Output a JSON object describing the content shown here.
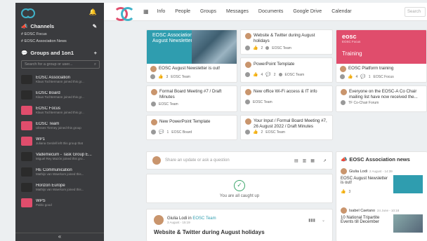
{
  "sidebar": {
    "channels_label": "Channels",
    "channels": [
      "# EOSC Focus",
      "# EOSC Association News"
    ],
    "groups_label": "Groups and 1on1",
    "search_placeholder": "Search for a group or user...",
    "groups": [
      {
        "name": "EOSC Association",
        "sub": "Klaus Tochtermann joined this gr...",
        "color": "#2b2b2b"
      },
      {
        "name": "EOSC Board",
        "sub": "Klaus Tochtermann joined this gr...",
        "color": "#2b2b2b"
      },
      {
        "name": "EOSC Focus",
        "sub": "Klaus Tochtermann joined this gr...",
        "color": "#e04d6c"
      },
      {
        "name": "EOSC Team",
        "sub": "Ulisses Tierney joined this group",
        "color": "#e04d6c"
      },
      {
        "name": "WP1",
        "sub": "Juliana Gerdell left this group that",
        "color": "#e04d6c"
      },
      {
        "name": "Vademecum - Task Group E...",
        "sub": "Miguel Rey Mazón joined this gro...",
        "color": "#2b2b2b"
      },
      {
        "name": "HE Communication",
        "sub": "Mathijs van Waerkom joined this...",
        "color": "#2b2b2b"
      },
      {
        "name": "Horizon Europe",
        "sub": "Mathijs van Waerkom joined this...",
        "color": "#2b2b2b"
      },
      {
        "name": "WPS",
        "sub": "Pablo good",
        "color": "#e04d6c"
      }
    ],
    "collapse_glyph": "«"
  },
  "nav": {
    "items": [
      "Info",
      "People",
      "Groups",
      "Messages",
      "Documents",
      "Google Drive",
      "Calendar"
    ],
    "search_placeholder": "Search"
  },
  "tiles": {
    "hero1": {
      "title": "EOSC Association August Newsletter",
      "caption": "EOSC August Newsletter is out!",
      "likes": "3",
      "team": "EOSC Team"
    },
    "t1": {
      "title": "Website & Twitter during August holidays",
      "likes": "2",
      "team": "EOSC Team"
    },
    "t2": {
      "title": "PowerPoint Template",
      "likes": "4",
      "comments": "2",
      "team": "EOSC Team"
    },
    "hero3": {
      "brand": "eosc",
      "brand_sub": "EOSC Focus",
      "label": "Training",
      "caption": "EOSC Platform training",
      "likes": "4",
      "comments": "1",
      "team": "EOSC Focus"
    },
    "t3": {
      "title": "Formal Board Meeting #7 / Draft Minutes",
      "team": "EOSC Team"
    },
    "t4": {
      "title": "New office Wi-Fi access & IT info",
      "team": "EOSC Team"
    },
    "t5": {
      "title": "Everyone on the EOSC-A Co Chair mailing list have now received the...",
      "team": "TF Co-Chair Forum"
    },
    "t6": {
      "title": "New PowerPoint Template",
      "comments": "1",
      "team": "EOSC Board"
    },
    "t7": {
      "title": "Your Input / Formal Board Meeting #7, 26 August 2022 / Draft Minutes",
      "likes": "2",
      "team": "EOSC Team"
    }
  },
  "composer": {
    "placeholder": "Share an update or ask a question"
  },
  "caught_up": "You are all caught up",
  "post": {
    "author": "Giulia Lodi",
    "in": "in",
    "team": "EOSC Team",
    "date": "3 August - 15:19",
    "title": "Website & Twitter during August holidays"
  },
  "news": {
    "title": "EOSC Association news",
    "items": [
      {
        "author": "Giulia Lodi",
        "date": "2 August - 14:39",
        "text": "EOSC August Newsletter is out!",
        "likes": "3"
      },
      {
        "author": "Isabel Caetano",
        "date": "24 June - 10:18",
        "text": "10 National Tripartite Events till December"
      }
    ]
  },
  "colors": {
    "teal": "#2f9daf",
    "pink": "#e04d6c",
    "sidebar": "#3a3b3e"
  }
}
